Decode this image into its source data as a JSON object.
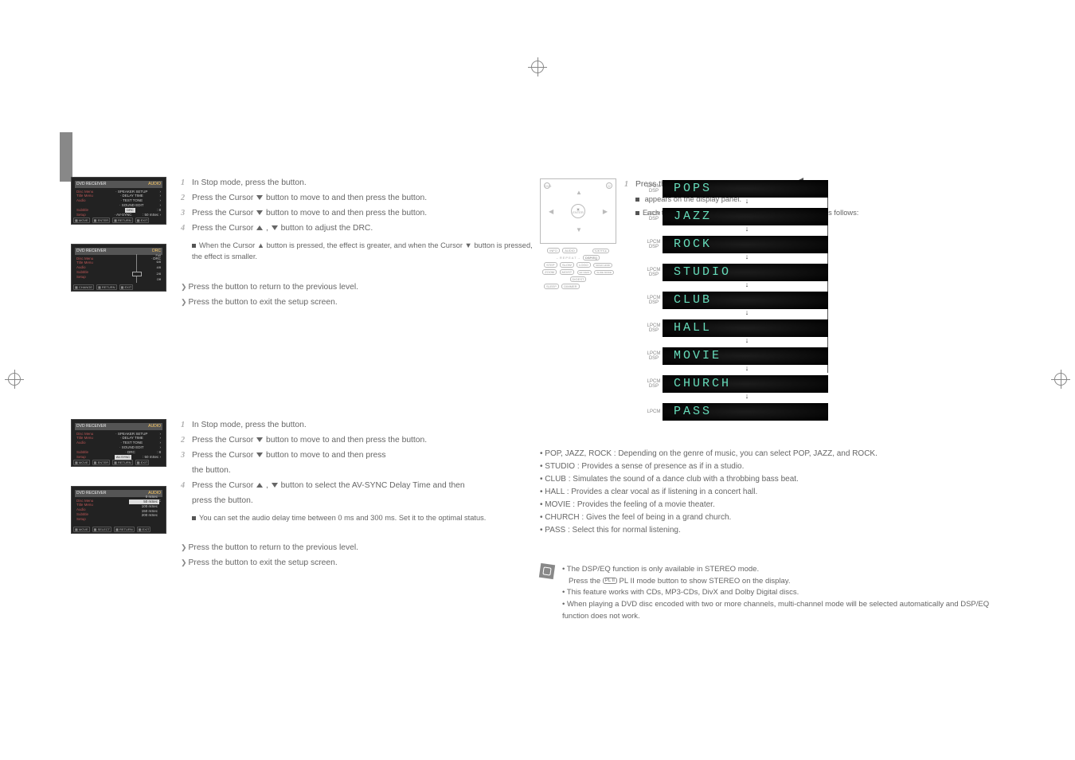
{
  "left": {
    "section1": {
      "step1": {
        "a": "In Stop mode, press the ",
        "b": " button."
      },
      "step2": {
        "a": "Press the Cursor ",
        "b": " button to move to ",
        "c": " and then press the ",
        "d": " button."
      },
      "step3": {
        "a": "Press the Cursor ",
        "b": " button to move to ",
        "c": " and then press the ",
        "d": " button."
      },
      "step4": {
        "a": "Press the Cursor ",
        "b": " button to adjust the DRC."
      },
      "note": "When the Cursor ▲ button is pressed, the effect is greater, and when the Cursor ▼ button is pressed, the effect is smaller.",
      "ret": {
        "a": "Press the ",
        "b": " button to return to the previous level."
      },
      "exit": {
        "a": "Press the ",
        "b": " button to exit the setup screen."
      }
    },
    "section2": {
      "step1": {
        "a": "In Stop mode, press the ",
        "b": " button."
      },
      "step2": {
        "a": "Press the Cursor ",
        "b": " button to move to ",
        "c": " and then press the ",
        "d": " button."
      },
      "step3": {
        "a": "Press the Cursor ",
        "b": " button to move to ",
        "c": " and then press"
      },
      "step3b": {
        "a": "the ",
        "b": " button."
      },
      "step4": {
        "a": "Press the Cursor ",
        "b": " button to select the AV-SYNC Delay Time  and then"
      },
      "step4b": {
        "a": "press the ",
        "b": " button."
      },
      "note": "You can set the audio delay time between 0 ms and 300 ms. Set it to the optimal status.",
      "ret": {
        "a": "Press the ",
        "b": " button to return to the previous level."
      },
      "exit": {
        "a": "Press the ",
        "b": " button to exit the setup screen."
      }
    },
    "thumbs": {
      "audio_label": "AUDIO",
      "menus": [
        "Disc Menu",
        "Title Menu",
        "Audio",
        "Subtitle",
        "Setup"
      ],
      "items1": [
        "SPEAKER SETUP",
        "DELAY TIME",
        "TEST TONE",
        "SOUND EDIT",
        "DRC",
        "AV-SYNC"
      ],
      "drc_items": [
        "DRC"
      ],
      "drc_ticks": [
        "Full",
        "6/8",
        "4/8",
        "2/8",
        "Off"
      ],
      "sync_label": "AV-SYNC",
      "sync_opts": [
        "0 mSec",
        "50 mSec",
        "100 mSec",
        "150 mSec",
        "200 mSec"
      ],
      "sync_sel": "50 mSec",
      "footer": [
        "MOVE",
        "ENTER",
        "RETURN",
        "EXIT"
      ],
      "footer2": [
        "CHANGE",
        "RETURN",
        "EXIT"
      ],
      "footer3": [
        "MOVE",
        "SELECT",
        "RETURN",
        "EXIT"
      ]
    }
  },
  "right": {
    "step1": {
      "a": "Press the ",
      "b": " button."
    },
    "note1": " appears on the display panel.",
    "note2": "Each time the button is pressed, the selection changes as follows:",
    "remote": {
      "enter": "ENTER",
      "dvd": "DVD",
      "power": "⏻",
      "info": "INFO",
      "audio": "AUDIO",
      "dspeq": "DSP/EQ",
      "keys1": [
        "STEP",
        "SLOW",
        "LOGO",
        "SD/HD HDMI"
      ],
      "keys2": [
        "ZOOM",
        "MO/ST",
        "EZ VIEW",
        "SLIDE MODE",
        "DIGEST"
      ],
      "keys3": [
        "SLEEP",
        "DIMMER"
      ],
      "caption": "SUB TITLE",
      "repeat": "REPEAT"
    },
    "dsp_label_top": "LPCM",
    "dsp_label_bot": "DSP",
    "dsp_modes": [
      "POPS",
      "JAZZ",
      "ROCK",
      "STUDIO",
      "CLUB",
      "HALL",
      "MOVIE",
      "CHURCH",
      "PASS"
    ],
    "desc": [
      "POP, JAZZ, ROCK : Depending on the genre of music, you can select POP, JAZZ, and ROCK.",
      "STUDIO : Provides a sense of presence as if in a studio.",
      "CLUB : Simulates the sound of a dance club with a throbbing bass beat.",
      "HALL : Provides a clear vocal as if listening in a concert hall.",
      "MOVIE : Provides the feeling of a movie theater.",
      "CHURCH : Gives the feel of being in a grand church.",
      "PASS : Select this for normal listening."
    ],
    "notes": [
      "The DSP/EQ function is only available in STEREO mode.",
      "Press the  PL II mode button to show STEREO on the display.",
      "This feature works with CDs, MP3-CDs, DivX and Dolby Digital discs.",
      "When playing a DVD disc encoded with two or more channels, multi-channel mode will be selected automatically and DSP/EQ function does not work."
    ],
    "pl_btn": "PL II"
  }
}
